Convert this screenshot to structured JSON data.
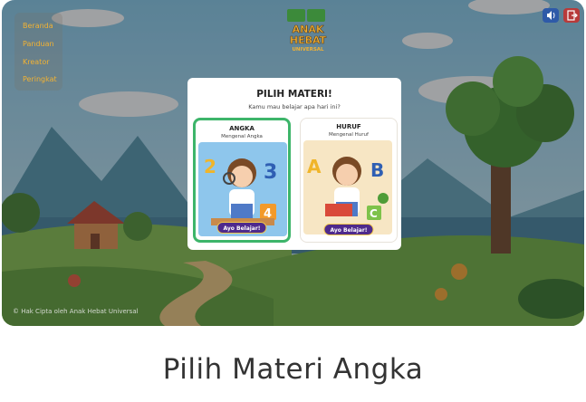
{
  "nav": {
    "items": [
      "Beranda",
      "Panduan",
      "Kreator",
      "Peringkat"
    ]
  },
  "logo": {
    "line1": "ANAK",
    "line2": "HEBAT",
    "line3": "UNIVERSAL"
  },
  "toolbar": {
    "sound_icon": "speaker-icon",
    "logout_icon": "logout-icon"
  },
  "footer": {
    "copyright": "© Hak Cipta oleh Anak Hebat Universal"
  },
  "modal": {
    "title": "PILIH MATERI!",
    "subtitle": "Kamu mau belajar apa hari ini?",
    "cards": [
      {
        "title": "ANGKA",
        "subtitle": "Mengenal Angka",
        "button": "Ayo Belajar!",
        "selected": true
      },
      {
        "title": "HURUF",
        "subtitle": "Mengenal Huruf",
        "button": "Ayo Belajar!",
        "selected": false
      }
    ]
  },
  "caption": "Pilih Materi Angka",
  "colors": {
    "nav_text": "#f2b233",
    "selected_border": "#3db56a",
    "button_bg": "#4e2a8c",
    "sound_btn": "#2e5aa8",
    "logout_btn": "#b83a3a"
  }
}
